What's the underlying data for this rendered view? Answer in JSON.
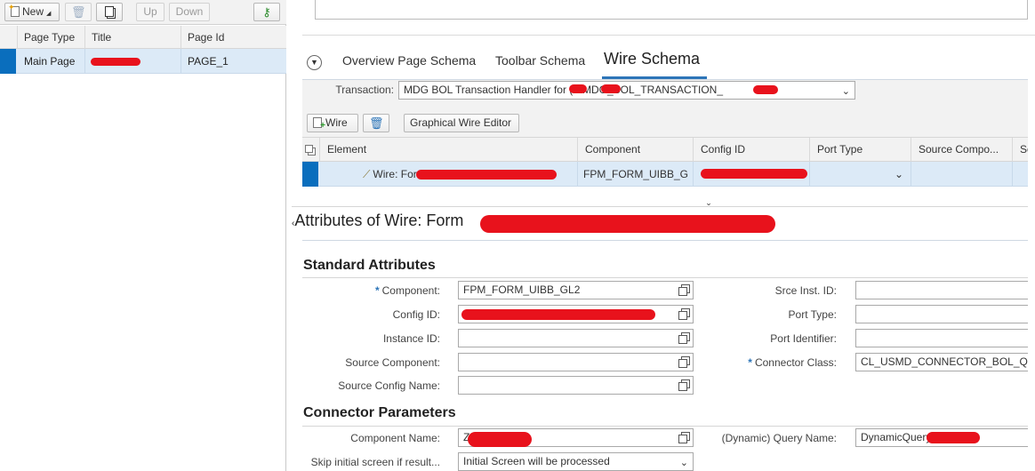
{
  "left": {
    "toolbar": {
      "new": "New",
      "up": "Up",
      "down": "Down"
    },
    "columns": [
      "Page Type",
      "Title",
      "Page Id"
    ],
    "row": {
      "page_type": "Main Page",
      "title": "",
      "page_id": "PAGE_1"
    }
  },
  "tabs": [
    "Overview Page Schema",
    "Toolbar Schema",
    "Wire Schema"
  ],
  "transaction": {
    "label": "Transaction:",
    "value": "MDG BOL Transaction Handler for (Z MDG_BOL_TRANSACTION_"
  },
  "wire_toolbar": {
    "wire": "Wire",
    "graphical": "Graphical Wire Editor"
  },
  "wire_table": {
    "columns": [
      "Element",
      "Component",
      "Config ID",
      "Port Type",
      "Source Compo...",
      "So"
    ],
    "row": {
      "element": "Wire: Form",
      "component": "FPM_FORM_UIBB_G",
      "config_id": "",
      "port_type": "",
      "source_component": ""
    }
  },
  "attributes_title": "Attributes of Wire: Form",
  "standard": {
    "title": "Standard Attributes",
    "component_label": "Component:",
    "component_value": "FPM_FORM_UIBB_GL2",
    "config_id_label": "Config ID:",
    "config_id_value": "",
    "instance_id_label": "Instance ID:",
    "instance_id_value": "",
    "source_component_label": "Source Component:",
    "source_component_value": "",
    "source_config_label": "Source Config Name:",
    "source_config_value": "",
    "srce_inst_label": "Srce Inst. ID:",
    "srce_inst_value": "",
    "port_type_label": "Port Type:",
    "port_type_value": "",
    "port_identifier_label": "Port Identifier:",
    "port_identifier_value": "",
    "connector_class_label": "Connector Class:",
    "connector_class_value": "CL_USMD_CONNECTOR_BOL_Q"
  },
  "connector": {
    "title": "Connector Parameters",
    "component_name_label": "Component Name:",
    "component_name_value": "Z",
    "query_label": "(Dynamic) Query Name:",
    "query_value": "DynamicQuery",
    "skip_label": "Skip initial screen if result...",
    "skip_value": "Initial Screen will be processed"
  },
  "colors": {
    "selection": "#dceaf7",
    "accent": "#2d75b8",
    "redaction": "#e8121c"
  }
}
